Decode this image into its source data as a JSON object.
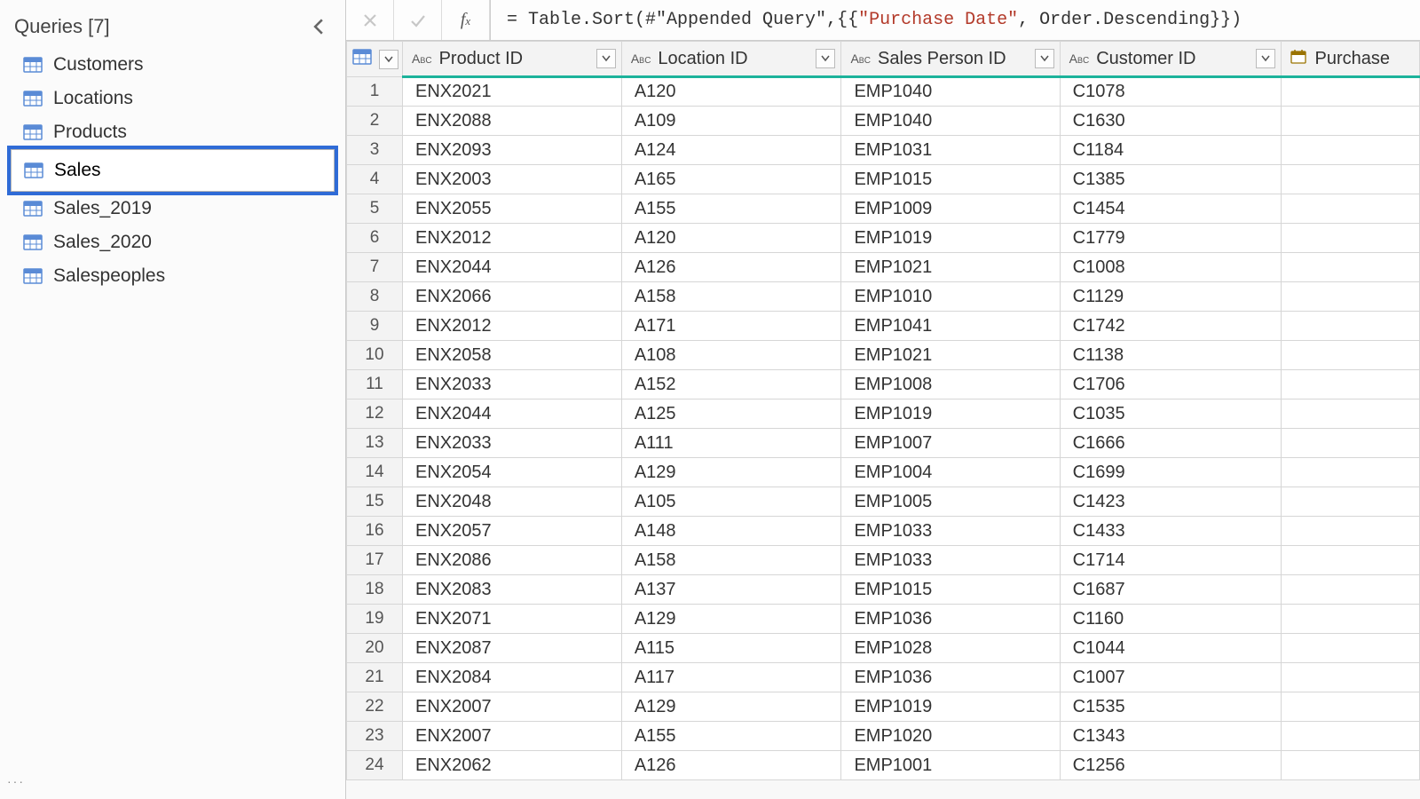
{
  "sidebar": {
    "title": "Queries [7]",
    "items": [
      {
        "label": "Customers"
      },
      {
        "label": "Locations"
      },
      {
        "label": "Products"
      },
      {
        "label": "Sales",
        "editing": true
      },
      {
        "label": "Sales_2019"
      },
      {
        "label": "Sales_2020"
      },
      {
        "label": "Salespeoples"
      }
    ]
  },
  "formula": {
    "prefix": "= Table.Sort(#\"Appended Query\",{{",
    "highlight": "\"Purchase Date\"",
    "suffix": ", Order.Descending}})"
  },
  "columns": {
    "product": "Product ID",
    "location": "Location ID",
    "salesperson": "Sales Person ID",
    "customer": "Customer ID",
    "purchase": "Purchase"
  },
  "rows": [
    {
      "n": "1",
      "product": "ENX2021",
      "location": "A120",
      "salesperson": "EMP1040",
      "customer": "C1078"
    },
    {
      "n": "2",
      "product": "ENX2088",
      "location": "A109",
      "salesperson": "EMP1040",
      "customer": "C1630"
    },
    {
      "n": "3",
      "product": "ENX2093",
      "location": "A124",
      "salesperson": "EMP1031",
      "customer": "C1184"
    },
    {
      "n": "4",
      "product": "ENX2003",
      "location": "A165",
      "salesperson": "EMP1015",
      "customer": "C1385"
    },
    {
      "n": "5",
      "product": "ENX2055",
      "location": "A155",
      "salesperson": "EMP1009",
      "customer": "C1454"
    },
    {
      "n": "6",
      "product": "ENX2012",
      "location": "A120",
      "salesperson": "EMP1019",
      "customer": "C1779"
    },
    {
      "n": "7",
      "product": "ENX2044",
      "location": "A126",
      "salesperson": "EMP1021",
      "customer": "C1008"
    },
    {
      "n": "8",
      "product": "ENX2066",
      "location": "A158",
      "salesperson": "EMP1010",
      "customer": "C1129"
    },
    {
      "n": "9",
      "product": "ENX2012",
      "location": "A171",
      "salesperson": "EMP1041",
      "customer": "C1742"
    },
    {
      "n": "10",
      "product": "ENX2058",
      "location": "A108",
      "salesperson": "EMP1021",
      "customer": "C1138"
    },
    {
      "n": "11",
      "product": "ENX2033",
      "location": "A152",
      "salesperson": "EMP1008",
      "customer": "C1706"
    },
    {
      "n": "12",
      "product": "ENX2044",
      "location": "A125",
      "salesperson": "EMP1019",
      "customer": "C1035"
    },
    {
      "n": "13",
      "product": "ENX2033",
      "location": "A111",
      "salesperson": "EMP1007",
      "customer": "C1666"
    },
    {
      "n": "14",
      "product": "ENX2054",
      "location": "A129",
      "salesperson": "EMP1004",
      "customer": "C1699"
    },
    {
      "n": "15",
      "product": "ENX2048",
      "location": "A105",
      "salesperson": "EMP1005",
      "customer": "C1423"
    },
    {
      "n": "16",
      "product": "ENX2057",
      "location": "A148",
      "salesperson": "EMP1033",
      "customer": "C1433"
    },
    {
      "n": "17",
      "product": "ENX2086",
      "location": "A158",
      "salesperson": "EMP1033",
      "customer": "C1714"
    },
    {
      "n": "18",
      "product": "ENX2083",
      "location": "A137",
      "salesperson": "EMP1015",
      "customer": "C1687"
    },
    {
      "n": "19",
      "product": "ENX2071",
      "location": "A129",
      "salesperson": "EMP1036",
      "customer": "C1160"
    },
    {
      "n": "20",
      "product": "ENX2087",
      "location": "A115",
      "salesperson": "EMP1028",
      "customer": "C1044"
    },
    {
      "n": "21",
      "product": "ENX2084",
      "location": "A117",
      "salesperson": "EMP1036",
      "customer": "C1007"
    },
    {
      "n": "22",
      "product": "ENX2007",
      "location": "A129",
      "salesperson": "EMP1019",
      "customer": "C1535"
    },
    {
      "n": "23",
      "product": "ENX2007",
      "location": "A155",
      "salesperson": "EMP1020",
      "customer": "C1343"
    },
    {
      "n": "24",
      "product": "ENX2062",
      "location": "A126",
      "salesperson": "EMP1001",
      "customer": "C1256"
    }
  ]
}
